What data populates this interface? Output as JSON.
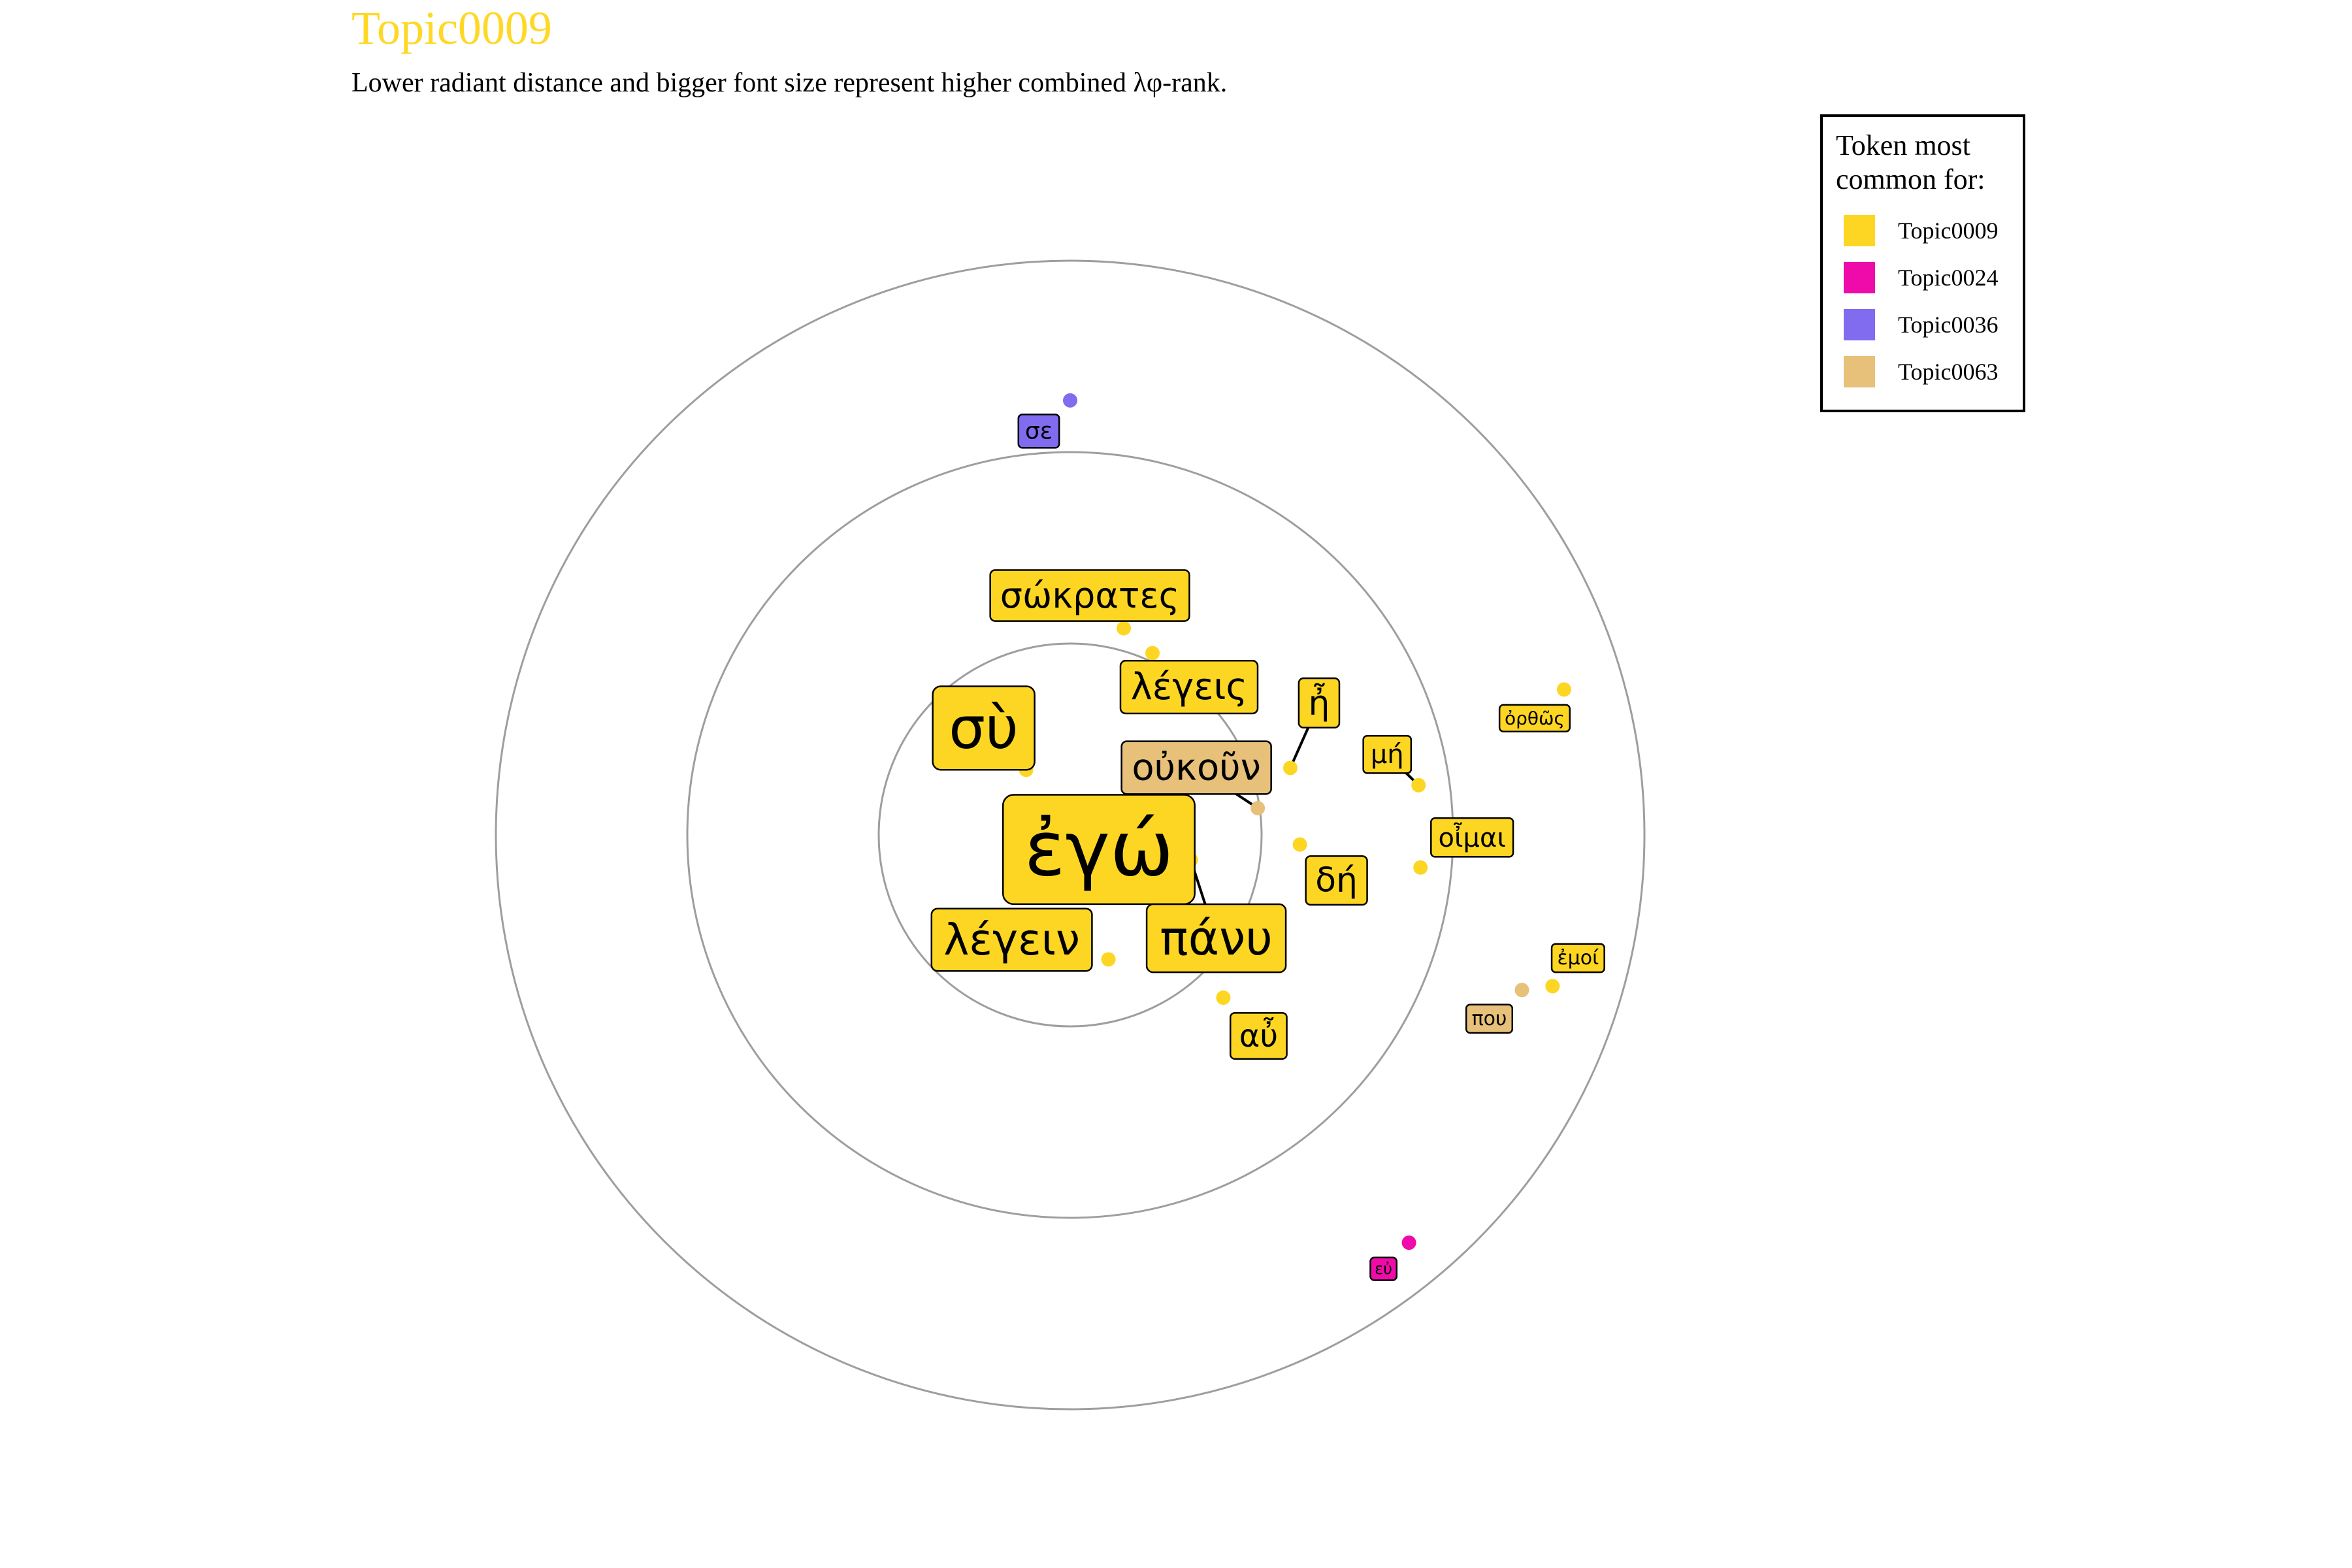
{
  "chart_data": {
    "type": "scatter",
    "title": "Topic0009",
    "subtitle": "Lower radiant distance and bigger font size represent higher combined λφ-rank.",
    "title_color": "#FFD826",
    "rings": [
      1,
      2,
      3
    ],
    "grid": "concentric circles",
    "legend": {
      "title_lines": [
        "Token most",
        "common for:"
      ],
      "placement": "top-right",
      "entries": [
        {
          "label": "Topic0009",
          "color": "#FDD623"
        },
        {
          "label": "Topic0024",
          "color": "#EE0BA9"
        },
        {
          "label": "Topic0036",
          "color": "#816CF0"
        },
        {
          "label": "Topic0063",
          "color": "#E7C079"
        }
      ]
    },
    "points": [
      {
        "token": "ἐγώ",
        "topic": "Topic0009",
        "x": 0.15,
        "y": 0.17,
        "rank": 1
      },
      {
        "token": "σὺ",
        "topic": "Topic0009",
        "x": -0.23,
        "y": 0.34,
        "rank": 2
      },
      {
        "token": "πάνυ",
        "topic": "Topic0009",
        "x": 0.63,
        "y": -0.13,
        "rank": 3
      },
      {
        "token": "λέγειν",
        "topic": "Topic0009",
        "x": 0.2,
        "y": -0.65,
        "rank": 4
      },
      {
        "token": "οὐκοῦν",
        "topic": "Topic0063",
        "x": 0.98,
        "y": 0.14,
        "rank": 5
      },
      {
        "token": "λέγεις",
        "topic": "Topic0009",
        "x": 0.43,
        "y": 0.95,
        "rank": 6
      },
      {
        "token": "σώκρατες",
        "topic": "Topic0009",
        "x": 0.28,
        "y": 1.08,
        "rank": 7
      },
      {
        "token": "ἦ",
        "topic": "Topic0009",
        "x": 1.15,
        "y": 0.35,
        "rank": 8
      },
      {
        "token": "δή",
        "topic": "Topic0009",
        "x": 1.2,
        "y": -0.05,
        "rank": 9
      },
      {
        "token": "αὖ",
        "topic": "Topic0009",
        "x": 0.8,
        "y": -0.85,
        "rank": 10
      },
      {
        "token": "μή",
        "topic": "Topic0009",
        "x": 1.82,
        "y": 0.26,
        "rank": 11
      },
      {
        "token": "οἶμαι",
        "topic": "Topic0009",
        "x": 1.83,
        "y": -0.17,
        "rank": 12
      },
      {
        "token": "σε",
        "topic": "Topic0036",
        "x": 0.0,
        "y": 2.27,
        "rank": 13
      },
      {
        "token": "που",
        "topic": "Topic0063",
        "x": 2.36,
        "y": -0.81,
        "rank": 14
      },
      {
        "token": "ἐμοί",
        "topic": "Topic0009",
        "x": 2.52,
        "y": -0.79,
        "rank": 15
      },
      {
        "token": "ὀρθῶς",
        "topic": "Topic0009",
        "x": 2.58,
        "y": 0.76,
        "rank": 16
      },
      {
        "token": "εὐ",
        "topic": "Topic0024",
        "x": 1.77,
        "y": -2.13,
        "rank": 17
      }
    ]
  }
}
